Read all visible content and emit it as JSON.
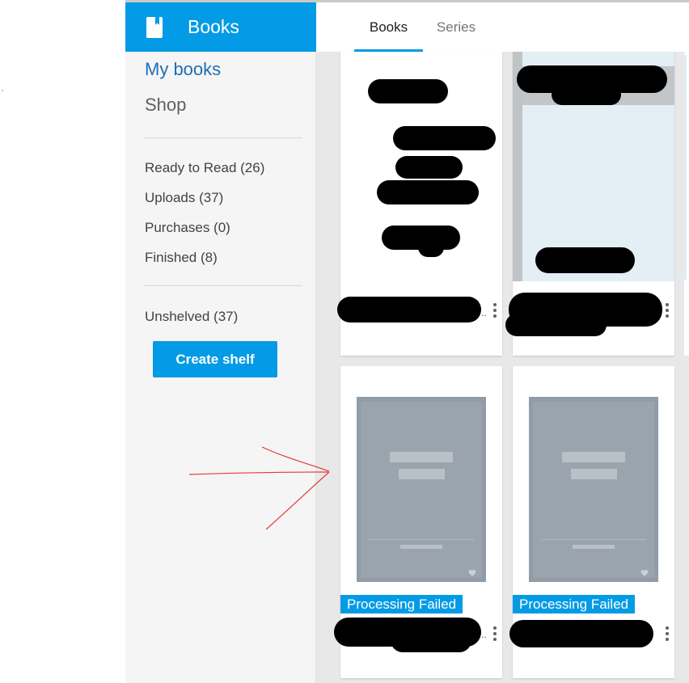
{
  "header": {
    "app_title": "Books",
    "tabs": [
      {
        "label": "Books",
        "active": true
      },
      {
        "label": "Series",
        "active": false
      }
    ]
  },
  "sidebar": {
    "primary": [
      {
        "label": "My books",
        "active": true
      },
      {
        "label": "Shop",
        "active": false
      }
    ],
    "shelves": [
      {
        "label": "Ready to Read (26)"
      },
      {
        "label": "Uploads (37)"
      },
      {
        "label": "Purchases (0)"
      },
      {
        "label": "Finished (8)"
      }
    ],
    "unshelved": "Unshelved (37)",
    "create_shelf_label": "Create shelf"
  },
  "books": [
    {
      "status": ""
    },
    {
      "status": ""
    },
    {
      "status": "Processing Failed"
    },
    {
      "status": "Processing Failed"
    }
  ],
  "colors": {
    "accent": "#039be5",
    "sidebar_bg": "#f5f5f5",
    "active_nav": "#1e6eb7",
    "annotation": "#e53935"
  },
  "icons": {
    "brand": "book-icon",
    "card_menu": "more-vert-icon"
  }
}
